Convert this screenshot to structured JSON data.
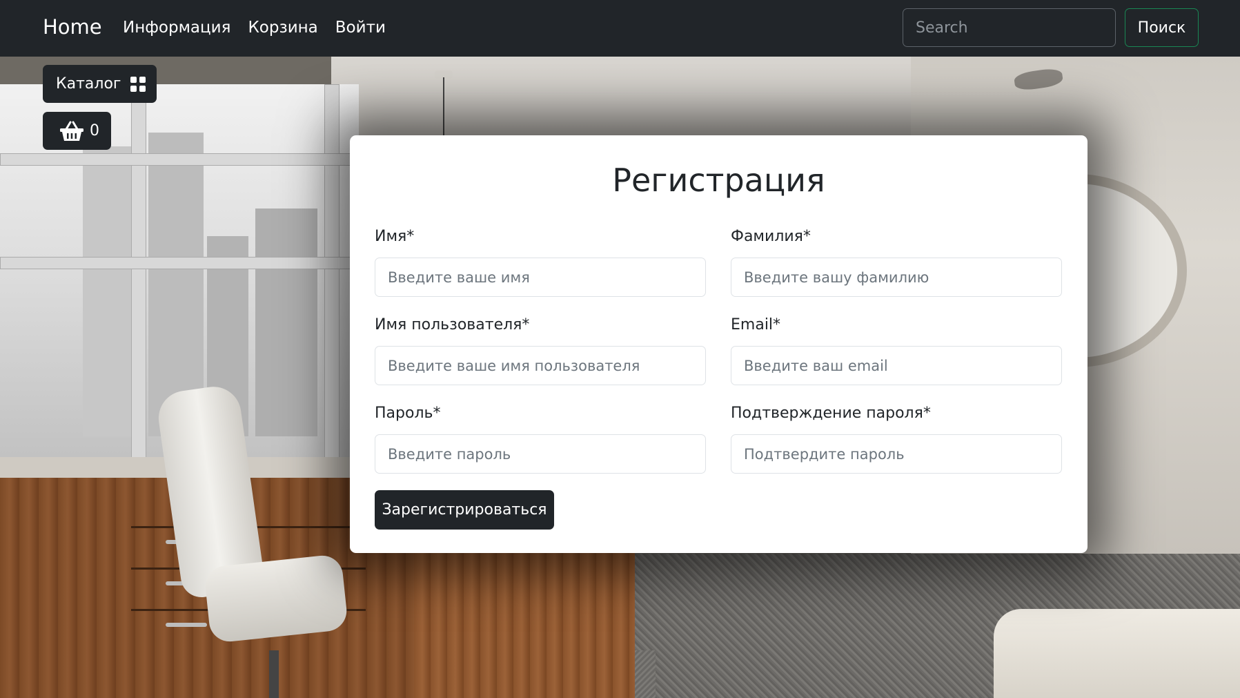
{
  "navbar": {
    "brand": "Home",
    "links": [
      "Информация",
      "Корзина",
      "Войти"
    ],
    "search_placeholder": "Search",
    "search_button": "Поиск"
  },
  "catalog_button": {
    "label": "Каталог",
    "icon": "grid-icon"
  },
  "cart_button": {
    "count": "0",
    "icon": "basket-icon"
  },
  "form": {
    "title": "Регистрация",
    "fields": [
      {
        "label": "Имя*",
        "placeholder": "Введите ваше имя"
      },
      {
        "label": "Фамилия*",
        "placeholder": "Введите вашу фамилию"
      },
      {
        "label": "Имя пользователя*",
        "placeholder": "Введите ваше имя пользователя"
      },
      {
        "label": "Email*",
        "placeholder": "Введите ваш email"
      },
      {
        "label": "Пароль*",
        "placeholder": "Введите пароль"
      },
      {
        "label": "Подтверждение пароля*",
        "placeholder": "Подтвердите пароль"
      }
    ],
    "submit_label": "Зарегистрироваться"
  },
  "colors": {
    "navbar_bg": "#212529",
    "search_button_border": "#198754",
    "card_bg": "#ffffff"
  }
}
